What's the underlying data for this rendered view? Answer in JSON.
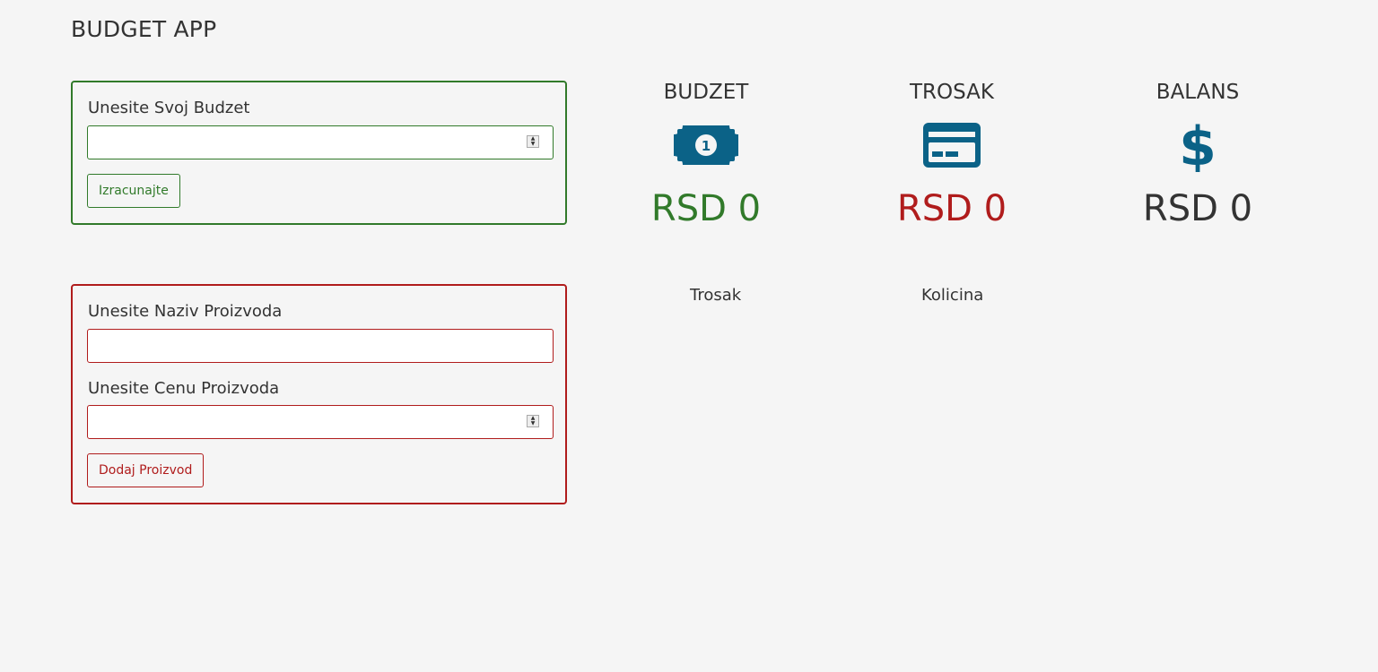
{
  "app": {
    "title": "BUDGET APP"
  },
  "colors": {
    "green": "#317a2a",
    "red": "#b01c1c",
    "blue": "#0b6287",
    "dark": "#333333"
  },
  "budget_form": {
    "label": "Unesite Svoj Budzet",
    "value": "",
    "button_label": "Izracunajte"
  },
  "expense_form": {
    "name_label": "Unesite Naziv Proizvoda",
    "name_value": "",
    "price_label": "Unesite Cenu Proizvoda",
    "price_value": "",
    "button_label": "Dodaj Proizvod"
  },
  "stats": {
    "budget": {
      "title": "BUDZET",
      "icon": "money-bill-icon",
      "value": "RSD 0"
    },
    "expense": {
      "title": "TROSAK",
      "icon": "credit-card-icon",
      "value": "RSD 0"
    },
    "balance": {
      "title": "BALANS",
      "icon": "dollar-sign-icon",
      "value": "RSD 0"
    }
  },
  "expense_list": {
    "columns": [
      "Trosak",
      "Kolicina"
    ]
  }
}
